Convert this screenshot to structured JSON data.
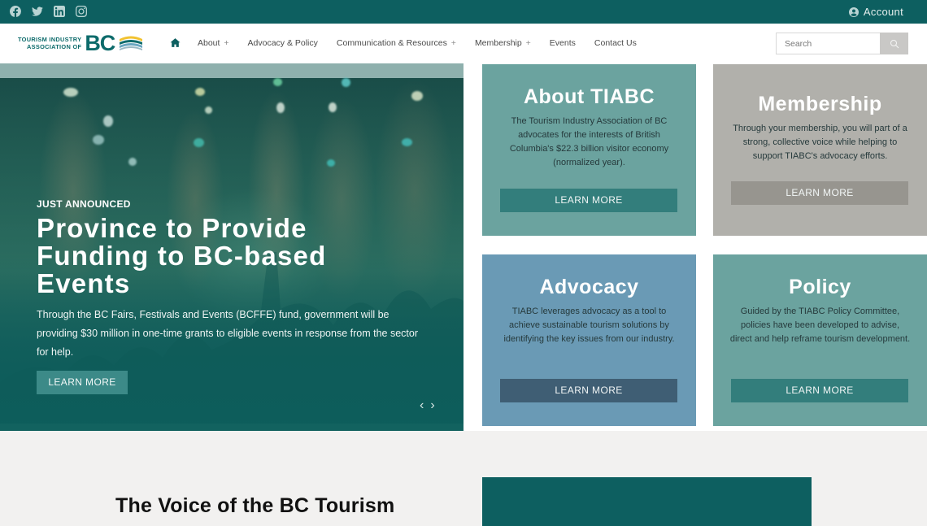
{
  "topbar": {
    "social": [
      "facebook",
      "twitter",
      "linkedin",
      "instagram"
    ],
    "account_label": "Account"
  },
  "header": {
    "logo": {
      "line1": "TOURISM INDUSTRY",
      "line2": "ASSOCIATION OF",
      "mark": "BC"
    },
    "nav": [
      {
        "label": "About",
        "has_submenu": true
      },
      {
        "label": "Advocacy & Policy",
        "has_submenu": false
      },
      {
        "label": "Communication & Resources",
        "has_submenu": true
      },
      {
        "label": "Membership",
        "has_submenu": true
      },
      {
        "label": "Events",
        "has_submenu": false
      },
      {
        "label": "Contact Us",
        "has_submenu": false
      }
    ],
    "submenu_marker": "+",
    "search": {
      "placeholder": "Search",
      "value": ""
    }
  },
  "hero": {
    "eyebrow": "JUST ANNOUNCED",
    "title": "Province to Provide Funding to BC-based Events",
    "text": "Through the BC Fairs, Festivals and Events (BCFFE) fund, government will be providing $30 million in one-time grants to eligible events in response from the sector for help.",
    "button": "LEARN MORE",
    "prev": "‹",
    "next": "›"
  },
  "cards": [
    {
      "title": "About TIABC",
      "text": "The Tourism Industry Association of BC advocates for the interests of British Columbia's $22.3 billion visitor economy (normalized year).",
      "button": "LEARN MORE",
      "color": "#6ba39f"
    },
    {
      "title": "Membership",
      "text": "Through your membership, you will part of a strong, collective voice while helping to support TIABC's advocacy efforts.",
      "button": "LEARN MORE",
      "color": "#b1b0ab"
    },
    {
      "title": "Advocacy",
      "text": "TIABC leverages advocacy as a tool to achieve sustainable tourism solutions by identifying the key issues from our industry.",
      "button": "LEARN MORE",
      "color": "#6a9ab5"
    },
    {
      "title": "Policy",
      "text": "Guided by the TIABC Policy Committee, policies have been developed to advise, direct and help reframe tourism development.",
      "button": "LEARN MORE",
      "color": "#6ba39f"
    }
  ],
  "lower": {
    "title": "The Voice of the BC Tourism"
  },
  "colors": {
    "brand_teal": "#0d5f60",
    "accent_yellow": "#f2c230"
  }
}
